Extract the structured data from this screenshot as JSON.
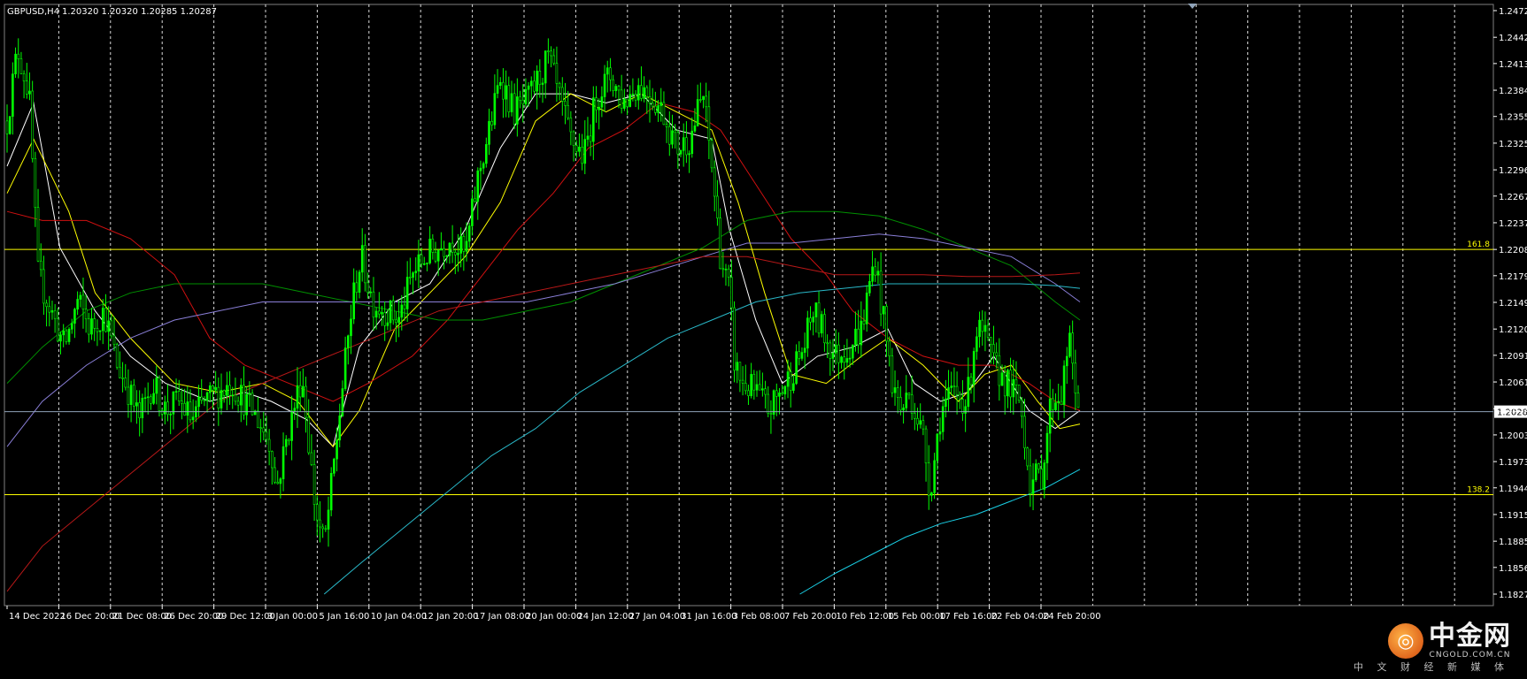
{
  "header": {
    "symbol": "GBPUSD,H4",
    "ohlc": "1.20320 1.20320 1.20285 1.20287"
  },
  "watermark": {
    "title": "中金网",
    "domain": "CNGOLD.COM.CN",
    "slogan": "中 文 财 经 新 媒 体"
  },
  "colors": {
    "background": "#000000",
    "grid": "#ffffff",
    "candle_bull": "#00ff00",
    "candle_bear": "#00ff00",
    "axis_text": "#ffffff",
    "fib_line": "#ffff00",
    "current_price_line": "#8fa3b8"
  },
  "chart_data": {
    "type": "candlestick",
    "symbol": "GBPUSD",
    "timeframe": "H4",
    "y_ticks": [
      "1.24720",
      "1.24425",
      "1.24135",
      "1.23840",
      "1.23550",
      "1.23255",
      "1.22960",
      "1.22670",
      "1.22375",
      "1.22080",
      "1.21790",
      "1.21495",
      "1.21200",
      "1.20910",
      "1.20615",
      "1.20320",
      "1.20030",
      "1.19735",
      "1.19445",
      "1.19150",
      "1.18855",
      "1.18565",
      "1.18270"
    ],
    "ylim": [
      1.1827,
      1.2472
    ],
    "x_ticks": [
      "14 Dec 2022",
      "16 Dec 20:00",
      "21 Dec 08:00",
      "26 Dec 20:00",
      "29 Dec 12:00",
      "3 Jan 00:00",
      "5 Jan 16:00",
      "10 Jan 04:00",
      "12 Jan 20:00",
      "17 Jan 08:00",
      "20 Jan 00:00",
      "24 Jan 12:00",
      "27 Jan 04:00",
      "31 Jan 16:00",
      "3 Feb 08:00",
      "7 Feb 20:00",
      "10 Feb 12:00",
      "15 Feb 00:00",
      "17 Feb 16:00",
      "22 Feb 04:00",
      "24 Feb 20:00"
    ],
    "current_price": {
      "label": "1.20287",
      "value": 1.20287
    },
    "fib_levels": [
      {
        "label": "161.8",
        "value": 1.2208
      },
      {
        "label": "138.2",
        "value": 1.1937
      }
    ],
    "price_path": [
      [
        0,
        1.235
      ],
      [
        12,
        1.243
      ],
      [
        25,
        1.238
      ],
      [
        35,
        1.218
      ],
      [
        50,
        1.214
      ],
      [
        65,
        1.21
      ],
      [
        80,
        1.215
      ],
      [
        95,
        1.212
      ],
      [
        110,
        1.214
      ],
      [
        125,
        1.208
      ],
      [
        135,
        1.206
      ],
      [
        150,
        1.202
      ],
      [
        165,
        1.206
      ],
      [
        180,
        1.203
      ],
      [
        195,
        1.204
      ],
      [
        210,
        1.202
      ],
      [
        225,
        1.204
      ],
      [
        240,
        1.205
      ],
      [
        255,
        1.206
      ],
      [
        270,
        1.204
      ],
      [
        285,
        1.202
      ],
      [
        300,
        1.199
      ],
      [
        305,
        1.194
      ],
      [
        320,
        1.201
      ],
      [
        335,
        1.207
      ],
      [
        350,
        1.192
      ],
      [
        360,
        1.188
      ],
      [
        370,
        1.196
      ],
      [
        380,
        1.205
      ],
      [
        392,
        1.215
      ],
      [
        402,
        1.22
      ],
      [
        415,
        1.215
      ],
      [
        430,
        1.214
      ],
      [
        445,
        1.213
      ],
      [
        460,
        1.218
      ],
      [
        475,
        1.22
      ],
      [
        490,
        1.221
      ],
      [
        505,
        1.222
      ],
      [
        520,
        1.22
      ],
      [
        535,
        1.229
      ],
      [
        550,
        1.235
      ],
      [
        560,
        1.24
      ],
      [
        575,
        1.236
      ],
      [
        590,
        1.237
      ],
      [
        605,
        1.24
      ],
      [
        615,
        1.242
      ],
      [
        625,
        1.238
      ],
      [
        640,
        1.233
      ],
      [
        655,
        1.231
      ],
      [
        670,
        1.238
      ],
      [
        685,
        1.24
      ],
      [
        700,
        1.237
      ],
      [
        715,
        1.239
      ],
      [
        730,
        1.238
      ],
      [
        745,
        1.236
      ],
      [
        760,
        1.232
      ],
      [
        775,
        1.233
      ],
      [
        790,
        1.238
      ],
      [
        800,
        1.23
      ],
      [
        810,
        1.22
      ],
      [
        820,
        1.216
      ],
      [
        826,
        1.208
      ],
      [
        835,
        1.206
      ],
      [
        850,
        1.205
      ],
      [
        865,
        1.203
      ],
      [
        878,
        1.205
      ],
      [
        890,
        1.207
      ],
      [
        905,
        1.21
      ],
      [
        915,
        1.214
      ],
      [
        925,
        1.212
      ],
      [
        940,
        1.209
      ],
      [
        955,
        1.21
      ],
      [
        970,
        1.212
      ],
      [
        985,
        1.22
      ],
      [
        995,
        1.213
      ],
      [
        1005,
        1.206
      ],
      [
        1015,
        1.203
      ],
      [
        1025,
        1.205
      ],
      [
        1040,
        1.2
      ],
      [
        1048,
        1.194
      ],
      [
        1060,
        1.203
      ],
      [
        1075,
        1.205
      ],
      [
        1090,
        1.204
      ],
      [
        1100,
        1.212
      ],
      [
        1110,
        1.211
      ],
      [
        1120,
        1.208
      ],
      [
        1135,
        1.206
      ],
      [
        1150,
        1.204
      ],
      [
        1162,
        1.195
      ],
      [
        1175,
        1.196
      ],
      [
        1185,
        1.204
      ],
      [
        1198,
        1.205
      ],
      [
        1205,
        1.211
      ],
      [
        1212,
        1.206
      ],
      [
        1218,
        1.2029
      ]
    ],
    "indicators": [
      {
        "type": "moving-average",
        "color": "#ffffff",
        "points": [
          [
            0,
            1.23
          ],
          [
            30,
            1.237
          ],
          [
            60,
            1.221
          ],
          [
            100,
            1.214
          ],
          [
            140,
            1.209
          ],
          [
            180,
            1.206
          ],
          [
            230,
            1.204
          ],
          [
            270,
            1.205
          ],
          [
            300,
            1.204
          ],
          [
            340,
            1.202
          ],
          [
            370,
            1.199
          ],
          [
            400,
            1.21
          ],
          [
            440,
            1.215
          ],
          [
            480,
            1.217
          ],
          [
            520,
            1.223
          ],
          [
            560,
            1.232
          ],
          [
            600,
            1.238
          ],
          [
            640,
            1.238
          ],
          [
            680,
            1.237
          ],
          [
            720,
            1.238
          ],
          [
            760,
            1.234
          ],
          [
            800,
            1.233
          ],
          [
            820,
            1.223
          ],
          [
            850,
            1.213
          ],
          [
            880,
            1.206
          ],
          [
            920,
            1.209
          ],
          [
            960,
            1.21
          ],
          [
            1000,
            1.212
          ],
          [
            1030,
            1.206
          ],
          [
            1060,
            1.204
          ],
          [
            1090,
            1.205
          ],
          [
            1120,
            1.209
          ],
          [
            1160,
            1.203
          ],
          [
            1190,
            1.201
          ],
          [
            1218,
            1.203
          ]
        ]
      },
      {
        "type": "moving-average",
        "color": "#ffff00",
        "points": [
          [
            0,
            1.227
          ],
          [
            30,
            1.233
          ],
          [
            70,
            1.225
          ],
          [
            100,
            1.216
          ],
          [
            140,
            1.211
          ],
          [
            190,
            1.206
          ],
          [
            240,
            1.205
          ],
          [
            290,
            1.206
          ],
          [
            330,
            1.204
          ],
          [
            370,
            1.199
          ],
          [
            400,
            1.203
          ],
          [
            440,
            1.212
          ],
          [
            480,
            1.216
          ],
          [
            520,
            1.22
          ],
          [
            560,
            1.226
          ],
          [
            600,
            1.235
          ],
          [
            640,
            1.238
          ],
          [
            680,
            1.236
          ],
          [
            720,
            1.238
          ],
          [
            760,
            1.236
          ],
          [
            800,
            1.234
          ],
          [
            830,
            1.226
          ],
          [
            860,
            1.216
          ],
          [
            890,
            1.207
          ],
          [
            930,
            1.206
          ],
          [
            970,
            1.209
          ],
          [
            1000,
            1.211
          ],
          [
            1040,
            1.208
          ],
          [
            1080,
            1.204
          ],
          [
            1110,
            1.207
          ],
          [
            1140,
            1.208
          ],
          [
            1170,
            1.204
          ],
          [
            1195,
            1.201
          ],
          [
            1218,
            1.2015
          ]
        ]
      },
      {
        "type": "moving-average",
        "color": "#d01010",
        "points": [
          [
            0,
            1.225
          ],
          [
            40,
            1.224
          ],
          [
            90,
            1.224
          ],
          [
            140,
            1.222
          ],
          [
            190,
            1.218
          ],
          [
            230,
            1.211
          ],
          [
            270,
            1.208
          ],
          [
            320,
            1.206
          ],
          [
            370,
            1.204
          ],
          [
            410,
            1.206
          ],
          [
            460,
            1.209
          ],
          [
            500,
            1.213
          ],
          [
            540,
            1.218
          ],
          [
            580,
            1.223
          ],
          [
            620,
            1.227
          ],
          [
            660,
            1.232
          ],
          [
            700,
            1.234
          ],
          [
            740,
            1.237
          ],
          [
            780,
            1.236
          ],
          [
            810,
            1.234
          ],
          [
            850,
            1.228
          ],
          [
            890,
            1.222
          ],
          [
            930,
            1.218
          ],
          [
            960,
            1.214
          ],
          [
            1000,
            1.211
          ],
          [
            1040,
            1.209
          ],
          [
            1080,
            1.208
          ],
          [
            1120,
            1.208
          ],
          [
            1160,
            1.206
          ],
          [
            1190,
            1.204
          ],
          [
            1218,
            1.203
          ]
        ]
      },
      {
        "type": "moving-average",
        "color": "#009000",
        "points": [
          [
            0,
            1.206
          ],
          [
            40,
            1.21
          ],
          [
            90,
            1.214
          ],
          [
            140,
            1.216
          ],
          [
            190,
            1.217
          ],
          [
            240,
            1.217
          ],
          [
            290,
            1.217
          ],
          [
            340,
            1.216
          ],
          [
            390,
            1.215
          ],
          [
            440,
            1.214
          ],
          [
            490,
            1.213
          ],
          [
            540,
            1.213
          ],
          [
            590,
            1.214
          ],
          [
            640,
            1.215
          ],
          [
            690,
            1.217
          ],
          [
            740,
            1.219
          ],
          [
            790,
            1.221
          ],
          [
            840,
            1.224
          ],
          [
            890,
            1.225
          ],
          [
            940,
            1.225
          ],
          [
            990,
            1.2245
          ],
          [
            1040,
            1.223
          ],
          [
            1090,
            1.221
          ],
          [
            1140,
            1.219
          ],
          [
            1190,
            1.215
          ],
          [
            1218,
            1.213
          ]
        ]
      },
      {
        "type": "moving-average",
        "color": "#8a7fd8",
        "points": [
          [
            0,
            1.199
          ],
          [
            40,
            1.204
          ],
          [
            90,
            1.208
          ],
          [
            140,
            1.211
          ],
          [
            190,
            1.213
          ],
          [
            240,
            1.214
          ],
          [
            290,
            1.215
          ],
          [
            340,
            1.215
          ],
          [
            390,
            1.215
          ],
          [
            440,
            1.215
          ],
          [
            490,
            1.215
          ],
          [
            540,
            1.215
          ],
          [
            590,
            1.215
          ],
          [
            640,
            1.216
          ],
          [
            690,
            1.217
          ],
          [
            740,
            1.2185
          ],
          [
            790,
            1.22
          ],
          [
            840,
            1.2215
          ],
          [
            890,
            1.2215
          ],
          [
            940,
            1.222
          ],
          [
            990,
            1.2225
          ],
          [
            1040,
            1.222
          ],
          [
            1090,
            1.221
          ],
          [
            1140,
            1.22
          ],
          [
            1190,
            1.217
          ],
          [
            1218,
            1.215
          ]
        ]
      },
      {
        "type": "moving-average",
        "color": "#b81818",
        "points": [
          [
            0,
            1.183
          ],
          [
            40,
            1.188
          ],
          [
            90,
            1.192
          ],
          [
            140,
            1.196
          ],
          [
            190,
            1.2
          ],
          [
            240,
            1.204
          ],
          [
            290,
            1.206
          ],
          [
            340,
            1.208
          ],
          [
            390,
            1.21
          ],
          [
            440,
            1.212
          ],
          [
            490,
            1.214
          ],
          [
            540,
            1.215
          ],
          [
            590,
            1.216
          ],
          [
            640,
            1.217
          ],
          [
            690,
            1.218
          ],
          [
            740,
            1.219
          ],
          [
            790,
            1.22
          ],
          [
            840,
            1.22
          ],
          [
            890,
            1.219
          ],
          [
            940,
            1.218
          ],
          [
            990,
            1.218
          ],
          [
            1040,
            1.218
          ],
          [
            1090,
            1.2178
          ],
          [
            1140,
            1.2178
          ],
          [
            1190,
            1.218
          ],
          [
            1218,
            1.2182
          ]
        ]
      },
      {
        "type": "moving-average",
        "color": "#29b8c8",
        "points": [
          [
            360,
            1.1827
          ],
          [
            400,
            1.186
          ],
          [
            450,
            1.19
          ],
          [
            500,
            1.194
          ],
          [
            550,
            1.198
          ],
          [
            600,
            1.201
          ],
          [
            650,
            1.205
          ],
          [
            700,
            1.208
          ],
          [
            750,
            1.211
          ],
          [
            800,
            1.213
          ],
          [
            850,
            1.215
          ],
          [
            900,
            1.216
          ],
          [
            950,
            1.2165
          ],
          [
            1000,
            1.217
          ],
          [
            1050,
            1.217
          ],
          [
            1100,
            1.217
          ],
          [
            1150,
            1.217
          ],
          [
            1190,
            1.2168
          ],
          [
            1218,
            1.2165
          ]
        ]
      },
      {
        "type": "moving-average",
        "color": "#1ad0e6",
        "points": [
          [
            900,
            1.1827
          ],
          [
            940,
            1.185
          ],
          [
            980,
            1.187
          ],
          [
            1020,
            1.189
          ],
          [
            1060,
            1.1905
          ],
          [
            1100,
            1.1915
          ],
          [
            1140,
            1.193
          ],
          [
            1180,
            1.1945
          ],
          [
            1218,
            1.1965
          ]
        ]
      }
    ]
  }
}
